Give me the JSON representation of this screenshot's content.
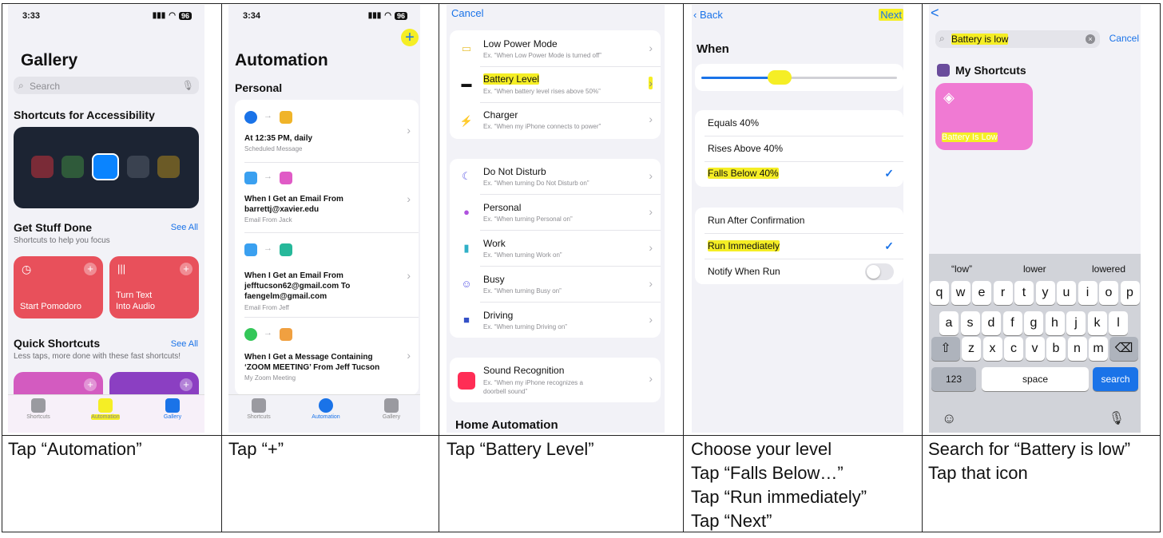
{
  "panel1": {
    "status_time": "3:33",
    "battery": "96",
    "title": "Gallery",
    "search_placeholder": "Search",
    "section_accessibility": "Shortcuts for Accessibility",
    "section_get_stuff": "Get Stuff Done",
    "get_stuff_sub": "Shortcuts to help you focus",
    "see_all": "See All",
    "tile1": "Start Pomodoro",
    "tile2": "Turn Text\nInto Audio",
    "section_quick": "Quick Shortcuts",
    "quick_sub": "Less taps, more done with these fast shortcuts!",
    "tabs": [
      "Shortcuts",
      "Automation",
      "Gallery"
    ],
    "caption": "Tap “Automation”"
  },
  "panel2": {
    "status_time": "3:34",
    "battery": "96",
    "plus": "+",
    "title": "Automation",
    "section": "Personal",
    "items": [
      {
        "title": "At 12:35 PM, daily",
        "sub": "Scheduled Message"
      },
      {
        "title": "When I Get an Email From\nbarrettj@xavier.edu",
        "sub": "Email From Jack"
      },
      {
        "title": "When I Get an Email From\njefftucson62@gmail.com To\nfaengelm@gmail.com",
        "sub": "Email From Jeff"
      },
      {
        "title": "When I Get a Message Containing\n‘ZOOM MEETING’ From Jeff Tucson",
        "sub": "My Zoom Meeting"
      }
    ],
    "tabs": [
      "Shortcuts",
      "Automation",
      "Gallery"
    ],
    "caption": "Tap “+”"
  },
  "panel3": {
    "cancel": "Cancel",
    "group1": [
      {
        "label": "Low Power Mode",
        "ex": "Ex. “When Low Power Mode is turned off”"
      },
      {
        "label": "Battery Level",
        "ex": "Ex. “When battery level rises above 50%”"
      },
      {
        "label": "Charger",
        "ex": "Ex. “When my iPhone connects to power”"
      }
    ],
    "group2": [
      {
        "label": "Do Not Disturb",
        "ex": "Ex. “When turning Do Not Disturb on”"
      },
      {
        "label": "Personal",
        "ex": "Ex. “When turning Personal on”"
      },
      {
        "label": "Work",
        "ex": "Ex. “When turning Work on”"
      },
      {
        "label": "Busy",
        "ex": "Ex. “When turning Busy on”"
      },
      {
        "label": "Driving",
        "ex": "Ex. “When turning Driving on”"
      }
    ],
    "sound_label": "Sound Recognition",
    "sound_ex": "Ex. “When my iPhone recognizes a\ndoorbell sound”",
    "home_automation": "Home Automation",
    "caption": "Tap “Battery Level”"
  },
  "panel4": {
    "back": "Back",
    "next": "Next",
    "when": "When",
    "slider_level": 0.4,
    "options": [
      "Equals 40%",
      "Rises Above 40%",
      "Falls Below 40%"
    ],
    "run_options": [
      "Run After Confirmation",
      "Run Immediately",
      "Notify When Run"
    ],
    "caption": "Choose your level\nTap “Falls Below…”\nTap “Run immediately”\nTap “Next”"
  },
  "panel5": {
    "back": "<",
    "search_value": "Battery is low",
    "cancel": "Cancel",
    "section": "My Shortcuts",
    "shortcut_name": "Battery Is Low",
    "suggestions": [
      "“low”",
      "lower",
      "lowered"
    ],
    "row1": [
      "q",
      "w",
      "e",
      "r",
      "t",
      "y",
      "u",
      "i",
      "o",
      "p"
    ],
    "row2": [
      "a",
      "s",
      "d",
      "f",
      "g",
      "h",
      "j",
      "k",
      "l"
    ],
    "row3": [
      "z",
      "x",
      "c",
      "v",
      "b",
      "n",
      "m"
    ],
    "key_123": "123",
    "key_space": "space",
    "key_search": "search",
    "caption": "Search for “Battery is low”\nTap that icon"
  }
}
